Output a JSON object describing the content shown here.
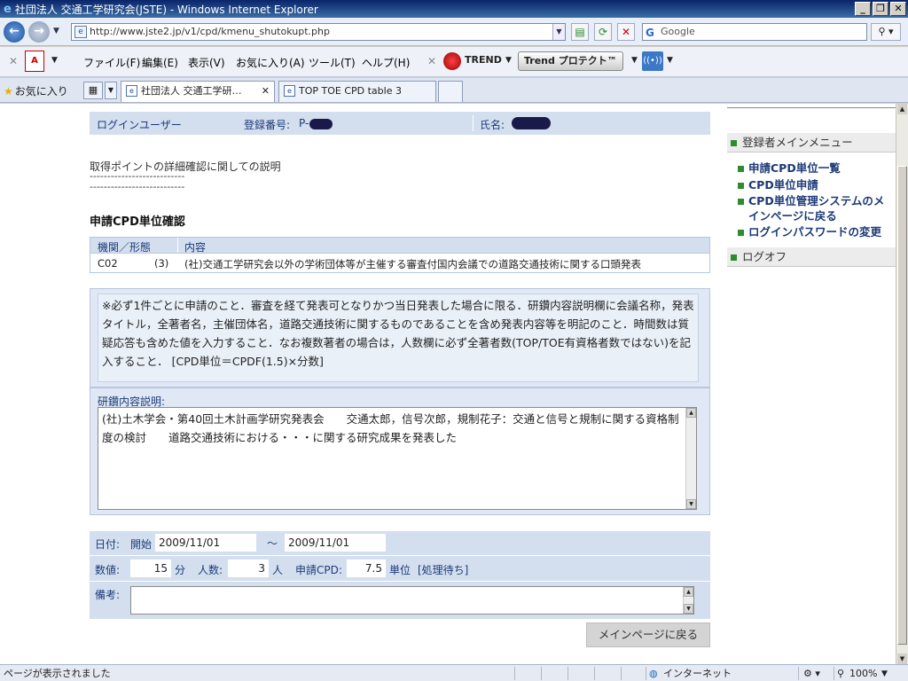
{
  "window": {
    "title": "社団法人 交通工学研究会(JSTE) - Windows Internet Explorer",
    "min_label": "_",
    "max_label": "❐",
    "close_label": "✕"
  },
  "address_bar": {
    "url": "http://www.jste2.jp/v1/cpd/kmenu_shutokupt.php",
    "search_placeholder": "Google"
  },
  "menu": {
    "items": [
      "ファイル(F)",
      "編集(E)",
      "表示(V)",
      "お気に入り(A)",
      "ツール(T)",
      "ヘルプ(H)"
    ],
    "trend_logo": "TREND",
    "trend_button": "Trend プロテクト™"
  },
  "favorites": {
    "label": "お気に入り",
    "tabs": [
      {
        "label": "社団法人 交通工学研…",
        "active": true
      },
      {
        "label": "TOP TOE CPD table 3",
        "active": false
      }
    ]
  },
  "user_bar": {
    "login_label": "ログインユーザー",
    "reg_label": "登録番号:",
    "reg_value_prefix": "P-",
    "name_label": "氏名:"
  },
  "explain": {
    "heading": "取得ポイントの詳細確認に関しての説明",
    "divider": "---------------------------"
  },
  "section": {
    "title": "申請CPD単位確認",
    "col_org": "機関／形態",
    "col_content": "内容",
    "row_code": "C02",
    "row_form": "(3)",
    "row_content": "(社)交通工学研究会以外の学術団体等が主催する審査付国内会議での道路交通技術に関する口頭発表"
  },
  "notice": "※必ず1件ごとに申請のこと．審査を経て発表可となりかつ当日発表した場合に限る．研鑽内容説明欄に会議名称，発表タイトル，全著者名，主催団体名，道路交通技術に関するものであることを含め発表内容等を明記のこと．時間数は質疑応答も含めた値を入力すること．なお複数著者の場合は，人数欄に必ず全著者数(TOP/TOE有資格者数ではない)を記入すること． [CPD単位＝CPDF(1.5)×分数]",
  "description": {
    "label": "研鑽内容説明:",
    "value": "(社)土木学会・第40回土木計画学研究発表会　　交通太郎，信号次郎，規制花子：交通と信号と規制に関する資格制度の検討　　道路交通技術における・・・に関する研究成果を発表した"
  },
  "dates": {
    "label": "日付:",
    "start_label": "開始",
    "start_value": "2009/11/01",
    "tilde": "～",
    "end_value": "2009/11/01"
  },
  "numbers": {
    "value_label": "数値:",
    "minutes": "15",
    "minutes_unit": "分",
    "people_label": "人数:",
    "people": "3",
    "people_unit": "人",
    "cpd_label": "申請CPD:",
    "cpd_value": "7.5",
    "cpd_unit": "単位",
    "status": "[処理待ち]"
  },
  "remarks": {
    "label": "備考:",
    "value": ""
  },
  "back_button": "メインページに戻る",
  "sidebar": {
    "menu_title": "登録者メインメニュー",
    "links": [
      "申請CPD単位一覧",
      "CPD単位申請",
      "CPD単位管理システムのメインページに戻る",
      "ログインパスワードの変更"
    ],
    "logoff": "ログオフ"
  },
  "status_bar": {
    "message": "ページが表示されました",
    "zone": "インターネット",
    "zoom": "100%"
  }
}
